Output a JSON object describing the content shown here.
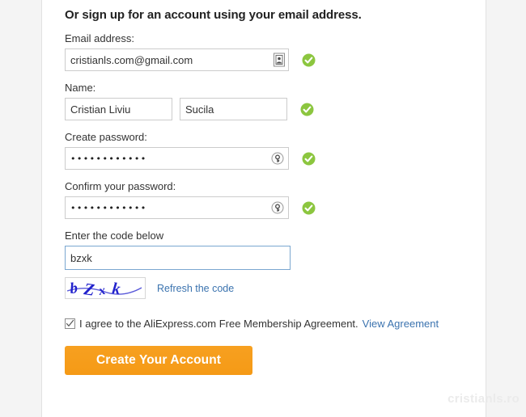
{
  "form": {
    "heading": "Or sign up for an account using your email address.",
    "email": {
      "label": "Email address:",
      "value": "cristianls.com@gmail.com",
      "placeholder": "",
      "icon": "contact-card-icon",
      "status": "valid"
    },
    "name": {
      "label": "Name:",
      "first_value": "Cristian Liviu",
      "first_placeholder": "",
      "last_value": "Sucila",
      "last_placeholder": "",
      "status": "valid"
    },
    "password": {
      "label": "Create password:",
      "value": "••••••••••••",
      "icon": "key-icon",
      "status": "valid"
    },
    "confirm_password": {
      "label": "Confirm your password:",
      "value": "••••••••••••",
      "icon": "key-icon",
      "status": "valid"
    },
    "captcha": {
      "label": "Enter the code below",
      "value": "bzxk",
      "placeholder": "",
      "image_text": "bZxk",
      "refresh_label": "Refresh the code"
    },
    "agreement": {
      "checked": true,
      "text": "I agree to the AliExpress.com Free Membership Agreement.",
      "link_label": "View Agreement"
    },
    "submit_label": "Create Your Account"
  },
  "watermark": "cristianls.ro",
  "colors": {
    "accent_button": "#f79c1e",
    "link": "#3b73af",
    "valid_check": "#8cc63f",
    "captcha_text": "#2222cc",
    "focus_border": "#7aa7d0"
  }
}
